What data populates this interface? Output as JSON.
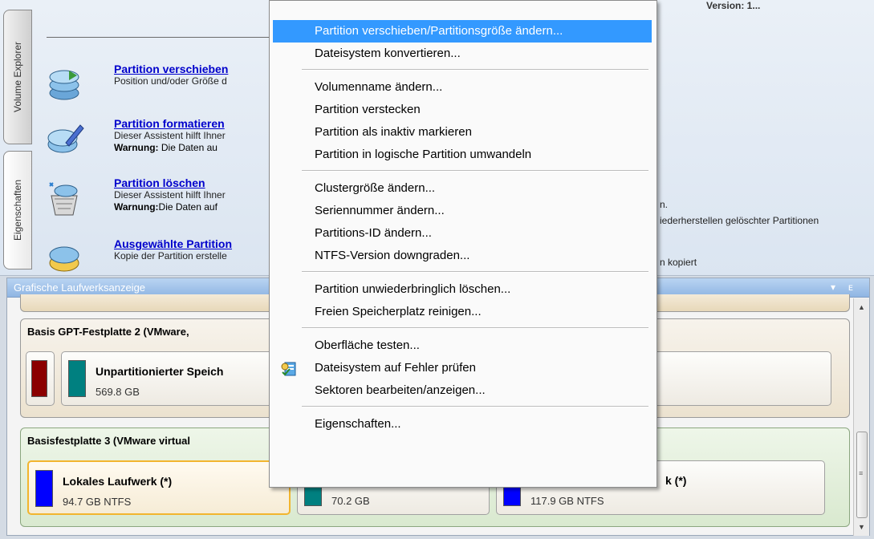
{
  "top_right_label": "Version: 1...",
  "tabs": {
    "volume_explorer": "Volume Explorer",
    "eigenschaften": "Eigenschaften"
  },
  "wizards": [
    {
      "link": "Partition verschieben",
      "desc": "Position und/oder Größe d",
      "warn_label": "",
      "warn_text": ""
    },
    {
      "link": "Partition formatieren",
      "desc": "Dieser Assistent hilft Ihner",
      "warn_label": "Warnung:",
      "warn_text": " Die Daten au"
    },
    {
      "link": "Partition löschen",
      "desc": "Dieser Assistent hilft Ihner",
      "warn_label": "Warnung:",
      "warn_text": "Die Daten auf"
    },
    {
      "link": "Ausgewählte Partition",
      "desc": "Kopie der Partition erstelle",
      "warn_label": "",
      "warn_text": ""
    }
  ],
  "right_snippets": {
    "r1": "n.",
    "r2": "iederherstellen gelöschter Partitionen",
    "r3": "n kopiert"
  },
  "lower_panel": {
    "title": "Grafische Laufwerksanzeige",
    "ctrl_pin": "▾",
    "ctrl_close": "ᴇ",
    "disk2": {
      "title": "Basis GPT-Festplatte 2 (VMware,",
      "partition": {
        "name": "Unpartitionierter Speich",
        "size": "569.8 GB"
      }
    },
    "disk3": {
      "title": "Basisfestplatte 3 (VMware virtual",
      "partitions": [
        {
          "name": "Lokales Laufwerk (*)",
          "size": "94.7 GB NTFS"
        },
        {
          "name": "",
          "size": "70.2 GB"
        },
        {
          "name": "k (*)",
          "size": "117.9 GB NTFS"
        }
      ]
    }
  },
  "menu": {
    "groups": [
      [
        "Partition verschieben/Partitionsgröße ändern...",
        "Dateisystem konvertieren..."
      ],
      [
        "Volumenname ändern...",
        "Partition verstecken",
        "Partition als inaktiv markieren",
        "Partition in logische Partition umwandeln"
      ],
      [
        "Clustergröße ändern...",
        "Seriennummer ändern...",
        "Partitions-ID ändern...",
        "NTFS-Version downgraden..."
      ],
      [
        "Partition unwiederbringlich löschen...",
        "Freien Speicherplatz reinigen..."
      ],
      [
        "Oberfläche testen...",
        "Dateisystem auf Fehler prüfen",
        "Sektoren bearbeiten/anzeigen..."
      ],
      [
        "Eigenschaften..."
      ]
    ],
    "highlighted_item": "Partition verschieben/Partitionsgröße ändern...",
    "highlight_color": "#3399ff"
  },
  "colors": {
    "disk2_system_swatch": "#8b0000",
    "disk2_unallocated_swatch": "#008080",
    "disk3_local_swatch": "#0000ff",
    "disk3_unallocated_swatch": "#008080",
    "disk3_third_swatch": "#0000ff",
    "selection_border": "#f2b52e"
  },
  "icons": {
    "wizard_icons": [
      "partition-move-icon",
      "partition-format-icon",
      "partition-delete-icon",
      "partition-copy-icon"
    ],
    "menu_check_icon": "filesystem-check-icon"
  }
}
